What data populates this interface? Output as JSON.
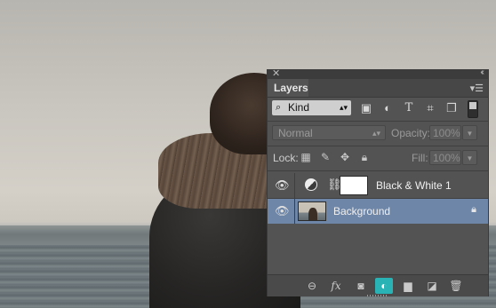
{
  "panel": {
    "tab_label": "Layers",
    "filter": {
      "kind_label": "Kind",
      "icons": [
        "image-filter-icon",
        "adjustment-filter-icon",
        "type-filter-icon",
        "shape-filter-icon",
        "smart-object-filter-icon"
      ],
      "type_glyph": "T"
    },
    "blend_mode": "Normal",
    "opacity_label": "Opacity:",
    "opacity_value": "100%",
    "lock_label": "Lock:",
    "fill_label": "Fill:",
    "fill_value": "100%"
  },
  "layers": [
    {
      "name": "Black & White 1",
      "visible": true,
      "selected": false,
      "type": "adjustment"
    },
    {
      "name": "Background",
      "visible": true,
      "selected": true,
      "locked": true,
      "type": "image"
    }
  ],
  "bottom_bar": [
    "link-layers-icon",
    "fx-icon",
    "add-mask-icon",
    "new-adjustment-layer-icon",
    "new-group-icon",
    "new-layer-icon",
    "delete-layer-icon"
  ],
  "bottom_bar_fx_label": "fx",
  "colors": {
    "panel_bg": "#535353",
    "selection": "#6e86a8",
    "active_button": "#2ab3b5"
  }
}
